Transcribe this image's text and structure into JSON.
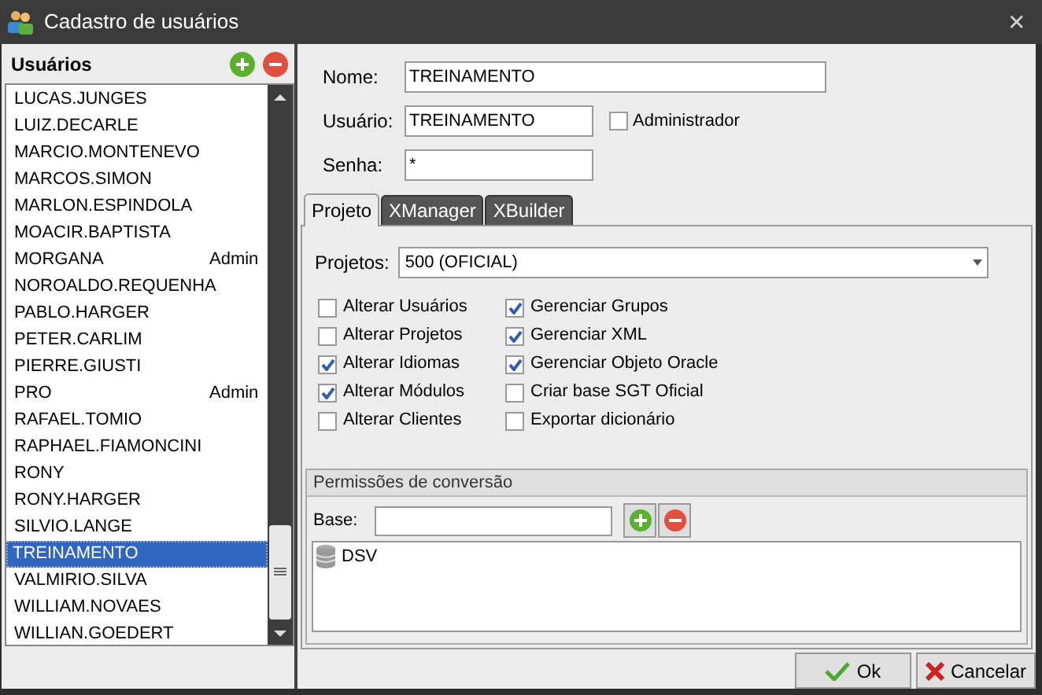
{
  "window": {
    "title": "Cadastro de usuários",
    "close": "✕"
  },
  "users_panel": {
    "title": "Usuários",
    "items": [
      {
        "name": "LUCAS.JUNGES",
        "selected": false
      },
      {
        "name": "LUIZ.DECARLE",
        "selected": false
      },
      {
        "name": "MARCIO.MONTENEVO",
        "selected": false
      },
      {
        "name": "MARCOS.SIMON",
        "selected": false
      },
      {
        "name": "MARLON.ESPINDOLA",
        "selected": false
      },
      {
        "name": "MOACIR.BAPTISTA",
        "selected": false
      },
      {
        "name": "MORGANA",
        "role": "Admin",
        "selected": false
      },
      {
        "name": "NOROALDO.REQUENHA",
        "selected": false
      },
      {
        "name": "PABLO.HARGER",
        "selected": false
      },
      {
        "name": "PETER.CARLIM",
        "selected": false
      },
      {
        "name": "PIERRE.GIUSTI",
        "selected": false
      },
      {
        "name": "PRO",
        "role": "Admin",
        "selected": false
      },
      {
        "name": "RAFAEL.TOMIO",
        "selected": false
      },
      {
        "name": "RAPHAEL.FIAMONCINI",
        "selected": false
      },
      {
        "name": "RONY",
        "selected": false
      },
      {
        "name": "RONY.HARGER",
        "selected": false
      },
      {
        "name": "SILVIO.LANGE",
        "selected": false
      },
      {
        "name": "TREINAMENTO",
        "selected": true
      },
      {
        "name": "VALMIRIO.SILVA",
        "selected": false
      },
      {
        "name": "WILLIAM.NOVAES",
        "selected": false
      },
      {
        "name": "WILLIAN.GOEDERT",
        "selected": false
      }
    ]
  },
  "form": {
    "nome_label": "Nome:",
    "nome": "TREINAMENTO",
    "usuario_label": "Usuário:",
    "usuario": "TREINAMENTO",
    "admin": {
      "label": "Administrador",
      "checked": false
    },
    "senha_label": "Senha:",
    "senha": "*"
  },
  "tabs": [
    {
      "label": "Projeto",
      "selected": true
    },
    {
      "label": "XManager",
      "selected": false
    },
    {
      "label": "XBuilder",
      "selected": false
    }
  ],
  "projeto": {
    "projetos_label": "Projetos:",
    "projetos": "500 (OFICIAL)",
    "permissions": [
      [
        {
          "label": "Alterar Usuários",
          "checked": false
        },
        {
          "label": "Alterar Projetos",
          "checked": false
        },
        {
          "label": "Alterar Idiomas",
          "checked": true
        },
        {
          "label": "Alterar Módulos",
          "checked": true
        },
        {
          "label": "Alterar Clientes",
          "checked": false
        }
      ],
      [
        {
          "label": "Gerenciar Grupos",
          "checked": true
        },
        {
          "label": "Gerenciar XML",
          "checked": true
        },
        {
          "label": "Gerenciar Objeto Oracle",
          "checked": true
        },
        {
          "label": "Criar base SGT Oficial",
          "checked": false
        },
        {
          "label": "Exportar dicionário",
          "checked": false
        }
      ]
    ]
  },
  "conversion": {
    "title": "Permissões de conversão",
    "base_label": "Base:",
    "bases": [
      "DSV"
    ]
  },
  "buttons": {
    "ok": "Ok",
    "cancel": "Cancelar"
  }
}
